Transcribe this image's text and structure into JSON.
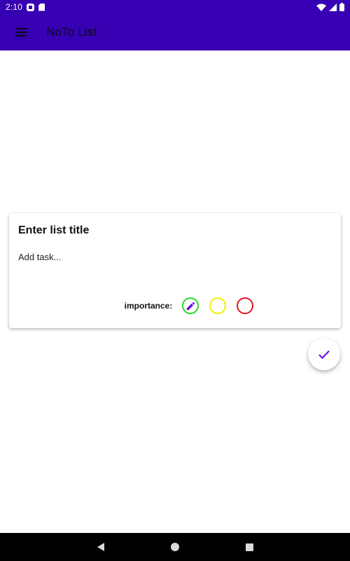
{
  "status_bar": {
    "time": "2:10",
    "icons": [
      "notification-icon",
      "sd-card-icon",
      "wifi-icon",
      "signal-icon",
      "battery-icon"
    ]
  },
  "app_bar": {
    "title": "NoTo List",
    "menu_icon": "menu-icon",
    "background": "#3700b3"
  },
  "card": {
    "title_placeholder": "Enter list title",
    "task_placeholder": "Add task...",
    "importance_label": "importance:",
    "importance_options": [
      {
        "name": "low",
        "color": "#22dd22",
        "selected": true
      },
      {
        "name": "medium",
        "color": "#f2ee00"
      },
      {
        "name": "high",
        "color": "#e0141e"
      }
    ]
  },
  "fab": {
    "icon": "check-icon",
    "icon_color": "#6200ee"
  },
  "nav_bar": {
    "buttons": [
      "back",
      "home",
      "recent-apps"
    ]
  }
}
